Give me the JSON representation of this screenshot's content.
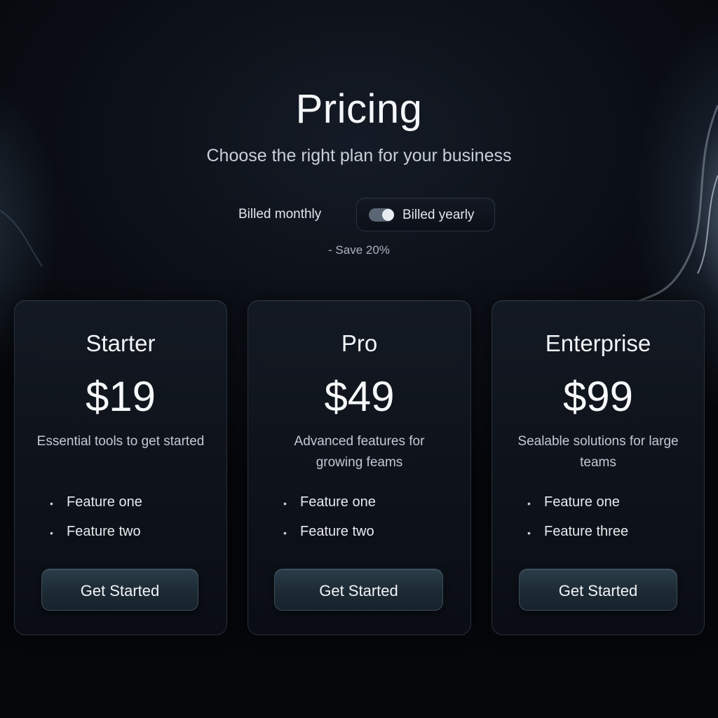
{
  "header": {
    "title": "Pricing",
    "subtitle": "Choose the right plan for your business"
  },
  "billing": {
    "monthly_label": "Billed monthly",
    "yearly_label": "Billed yearly",
    "yearly_selected": true,
    "save_note": "- Save 20%"
  },
  "plans": [
    {
      "name": "Starter",
      "price": "$19",
      "description": "Essential tools to get started",
      "features": [
        "Feature one",
        "Feature two"
      ],
      "cta": "Get Started"
    },
    {
      "name": "Pro",
      "price": "$49",
      "description": "Advanced features for growing feams",
      "features": [
        "Feature one",
        "Feature two"
      ],
      "cta": "Get Started"
    },
    {
      "name": "Enterprise",
      "price": "$99",
      "description": "Sealable solutions for large teams",
      "features": [
        "Feature one",
        "Feature three"
      ],
      "cta": "Get Started"
    }
  ],
  "colors": {
    "background": "#0b0f16",
    "card_border": "#27313d",
    "button": "#1c2a34",
    "toggle_track": "#5b6675"
  }
}
